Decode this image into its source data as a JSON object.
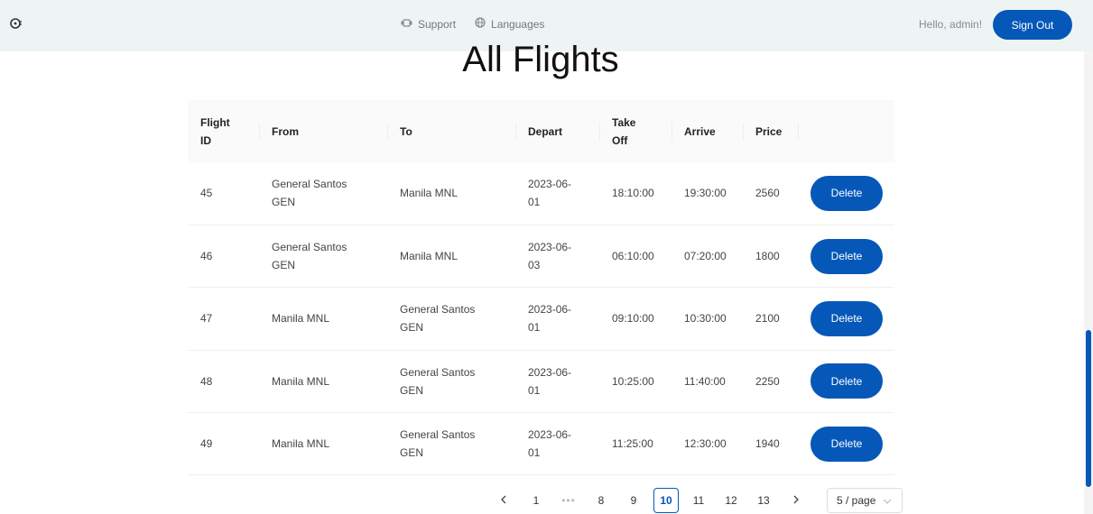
{
  "nav": {
    "support_label": "Support",
    "languages_label": "Languages",
    "greeting": "Hello, admin!",
    "signout_label": "Sign Out"
  },
  "page": {
    "title": "All Flights"
  },
  "table": {
    "headers": {
      "flight_id_line1": "Flight",
      "flight_id_line2": "ID",
      "from": "From",
      "to": "To",
      "depart": "Depart",
      "takeoff_line1": "Take",
      "takeoff_line2": "Off",
      "arrive": "Arrive",
      "price": "Price"
    },
    "rows": [
      {
        "id": "45",
        "from_line1": "General Santos",
        "from_line2": "GEN",
        "to_line1": "Manila MNL",
        "to_line2": "",
        "depart_line1": "2023-06-",
        "depart_line2": "01",
        "takeoff": "18:10:00",
        "arrive": "19:30:00",
        "price": "2560",
        "action": "Delete"
      },
      {
        "id": "46",
        "from_line1": "General Santos",
        "from_line2": "GEN",
        "to_line1": "Manila MNL",
        "to_line2": "",
        "depart_line1": "2023-06-",
        "depart_line2": "03",
        "takeoff": "06:10:00",
        "arrive": "07:20:00",
        "price": "1800",
        "action": "Delete"
      },
      {
        "id": "47",
        "from_line1": "Manila MNL",
        "from_line2": "",
        "to_line1": "General Santos",
        "to_line2": "GEN",
        "depart_line1": "2023-06-",
        "depart_line2": "01",
        "takeoff": "09:10:00",
        "arrive": "10:30:00",
        "price": "2100",
        "action": "Delete"
      },
      {
        "id": "48",
        "from_line1": "Manila MNL",
        "from_line2": "",
        "to_line1": "General Santos",
        "to_line2": "GEN",
        "depart_line1": "2023-06-",
        "depart_line2": "01",
        "takeoff": "10:25:00",
        "arrive": "11:40:00",
        "price": "2250",
        "action": "Delete"
      },
      {
        "id": "49",
        "from_line1": "Manila MNL",
        "from_line2": "",
        "to_line1": "General Santos",
        "to_line2": "GEN",
        "depart_line1": "2023-06-",
        "depart_line2": "01",
        "takeoff": "11:25:00",
        "arrive": "12:30:00",
        "price": "1940",
        "action": "Delete"
      }
    ]
  },
  "pagination": {
    "prev_icon": "chevron-left-icon",
    "next_icon": "chevron-right-icon",
    "pages": [
      "1",
      "•••",
      "8",
      "9",
      "10",
      "11",
      "12",
      "13"
    ],
    "current": "10",
    "page_size": "5 / page"
  },
  "colors": {
    "accent": "#0558b8",
    "navbar_bg": "#eef4f4",
    "header_bg": "#fafafa"
  }
}
